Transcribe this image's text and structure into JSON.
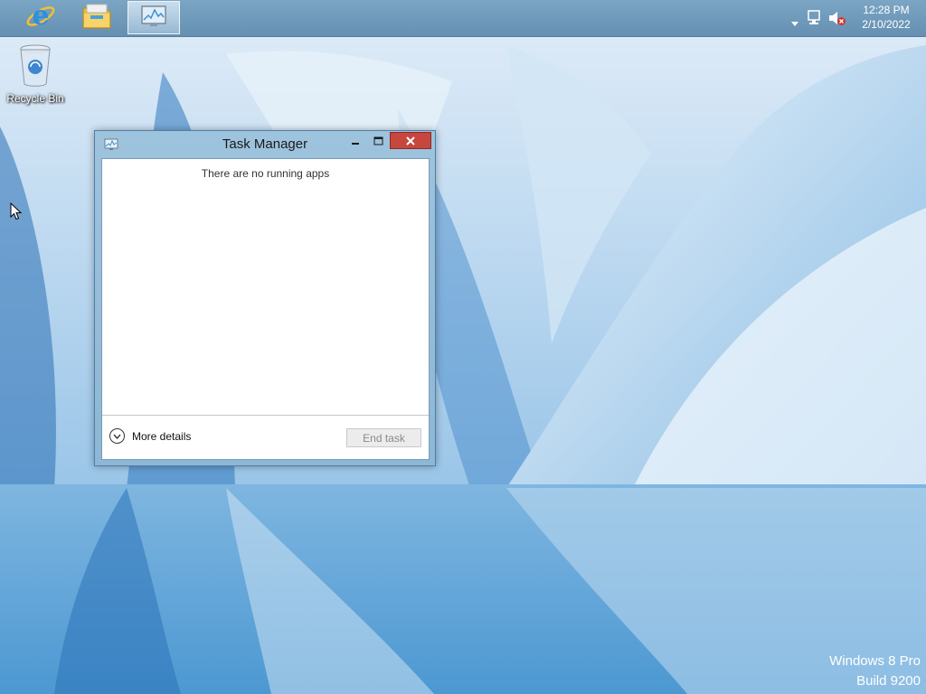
{
  "taskbar": {
    "pinned": [
      {
        "name": "internet-explorer",
        "icon": "ie-icon"
      },
      {
        "name": "file-explorer",
        "icon": "folder-icon"
      },
      {
        "name": "task-manager",
        "icon": "task-manager-icon",
        "active": true
      }
    ],
    "tray": {
      "show_hidden_icon": "chevron-up-icon",
      "network_icon": "network-icon",
      "volume_icon": "volume-muted-icon",
      "time": "12:28 PM",
      "date": "2/10/2022"
    }
  },
  "desktop": {
    "icons": [
      {
        "label": "Recycle Bin",
        "icon": "recycle-bin-icon"
      }
    ]
  },
  "window": {
    "title": "Task Manager",
    "empty_message": "There are no running apps",
    "more_details_label": "More details",
    "end_task_label": "End task",
    "end_task_enabled": false
  },
  "watermark": {
    "line1": "Windows 8 Pro",
    "line2": "Build 9200"
  },
  "colors": {
    "close_button": "#c7463d",
    "window_frame": "#9ec3dd"
  }
}
